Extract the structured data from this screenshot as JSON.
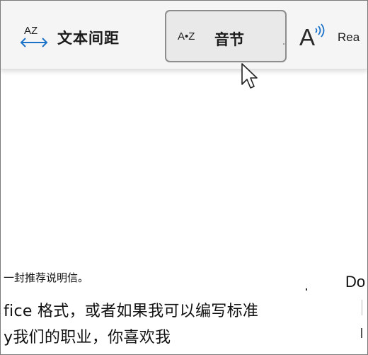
{
  "toolbar": {
    "text_spacing": {
      "icon_text": "AZ",
      "label": "文本间距"
    },
    "syllables": {
      "icon_text": "A•Z",
      "label": "音节"
    },
    "read_aloud": {
      "icon_text": "A",
      "label": "Rea"
    }
  },
  "document": {
    "line1": "一封推荐说明信。",
    "line2": "fice 格式，或者如果我可以编写标准",
    "line3": "y我们的职业，你喜欢我",
    "right_text": "Do"
  },
  "colors": {
    "toolbar_bg": "#f5f5f5",
    "selected_bg": "#e9e9e9",
    "arrow_blue": "#1a73c8",
    "border": "#7a7a7a"
  },
  "icons": [
    "text-spacing-icon",
    "syllables-icon",
    "read-aloud-icon",
    "mouse-cursor-icon"
  ]
}
